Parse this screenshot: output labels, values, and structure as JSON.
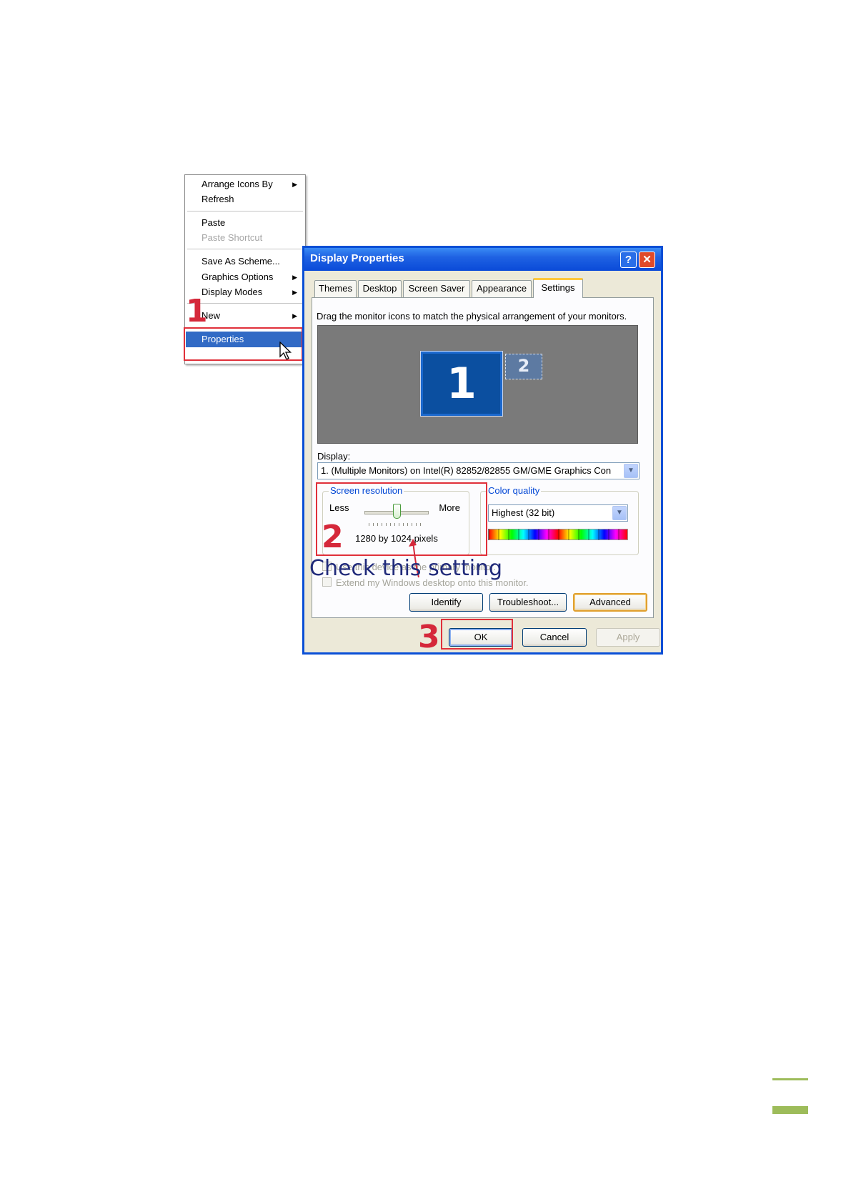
{
  "context_menu": {
    "items": [
      {
        "label": "Arrange Icons By",
        "submenu": true
      },
      {
        "label": "Refresh"
      },
      {
        "label": "Paste"
      },
      {
        "label": "Paste Shortcut",
        "disabled": true
      },
      {
        "label": "Save As Scheme..."
      },
      {
        "label": "Graphics Options",
        "submenu": true
      },
      {
        "label": "Display Modes",
        "submenu": true
      },
      {
        "label": "New",
        "submenu": true
      },
      {
        "label": "Properties",
        "selected": true
      }
    ],
    "submenu_arrow": "▶"
  },
  "annotations": {
    "step1": "1",
    "step2": "2",
    "step3": "3",
    "callout": "Check this setting",
    "color": "#e0303a"
  },
  "dialog": {
    "title": "Display Properties",
    "help_glyph": "?",
    "close_glyph": "✕",
    "tabs": [
      {
        "label": "Themes"
      },
      {
        "label": "Desktop"
      },
      {
        "label": "Screen Saver"
      },
      {
        "label": "Appearance"
      },
      {
        "label": "Settings",
        "active": true
      }
    ],
    "instruction": "Drag the monitor icons to match the physical arrangement of your monitors.",
    "monitors": {
      "primary": "1",
      "secondary": "2"
    },
    "display_label": "Display:",
    "display_value": "1. (Multiple Monitors) on Intel(R) 82852/82855 GM/GME Graphics Con",
    "screen_resolution": {
      "label": "Screen resolution",
      "less": "Less",
      "more": "More",
      "value_text": "1280 by 1024 pixels",
      "slider_fraction": 0.5
    },
    "color_quality": {
      "label": "Color quality",
      "value": "Highest (32 bit)"
    },
    "checkbox_primary": "Use this device as the primary monitor.",
    "checkbox_extend": "Extend my Windows desktop onto this monitor.",
    "buttons": {
      "identify": "Identify",
      "troubleshoot": "Troubleshoot...",
      "advanced": "Advanced",
      "ok": "OK",
      "cancel": "Cancel",
      "apply": "Apply"
    },
    "dropdown_glyph": "▼",
    "colors": {
      "title_bar": "#0a4ad8",
      "face": "#ece9d8",
      "accent_link": "#0046d5"
    }
  }
}
